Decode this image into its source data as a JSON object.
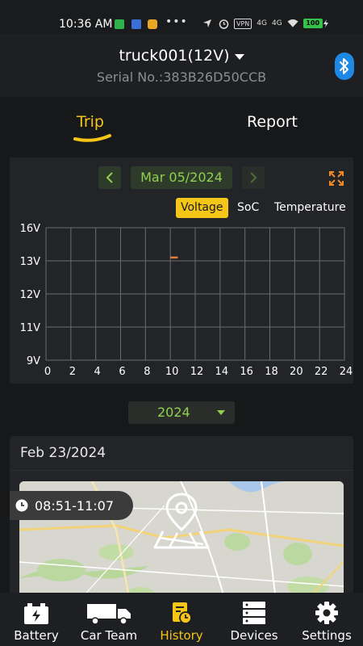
{
  "status_bar": {
    "time": "10:36 AM",
    "dots": "•••",
    "vpn": "VPN",
    "signal1": "4G",
    "signal2": "4G",
    "battery": "100"
  },
  "header": {
    "device_name": "truck001(12V)",
    "serial": "Serial No.:383B26D50CCB"
  },
  "tabs": [
    {
      "label": "Trip",
      "active": true
    },
    {
      "label": "Report",
      "active": false
    }
  ],
  "chart_panel": {
    "date": "Mar 05/2024",
    "modes": [
      {
        "label": "Voltage",
        "active": true
      },
      {
        "label": "SoC",
        "active": false
      },
      {
        "label": "Temperature",
        "active": false
      }
    ]
  },
  "chart_data": {
    "type": "line",
    "x_ticks": [
      "0",
      "2",
      "4",
      "6",
      "8",
      "10",
      "12",
      "14",
      "16",
      "18",
      "20",
      "22",
      "24"
    ],
    "y_ticks": [
      "16V",
      "13V",
      "12V",
      "11V",
      "9V"
    ],
    "xlim": [
      0,
      24
    ],
    "ylim": [
      9,
      16
    ],
    "grid": true,
    "series": [
      {
        "color": "#e07b39",
        "points": [
          {
            "x": 10.0,
            "y": 13.3
          },
          {
            "x": 10.6,
            "y": 13.3
          }
        ]
      }
    ]
  },
  "year_selector": {
    "value": "2024"
  },
  "trip_card": {
    "date": "Feb 23/2024",
    "time_range": "08:51-11:07"
  },
  "bottom_nav": [
    {
      "label": "Battery",
      "icon": "battery-icon",
      "active": false
    },
    {
      "label": "Car Team",
      "icon": "truck-icon",
      "active": false
    },
    {
      "label": "History",
      "icon": "history-icon",
      "active": true
    },
    {
      "label": "Devices",
      "icon": "devices-icon",
      "active": false
    },
    {
      "label": "Settings",
      "icon": "gear-icon",
      "active": false
    }
  ],
  "colors": {
    "accent": "#f5c518",
    "green_text": "#8fd14f",
    "bluetooth": "#1e88e5",
    "background": "#17181a"
  }
}
